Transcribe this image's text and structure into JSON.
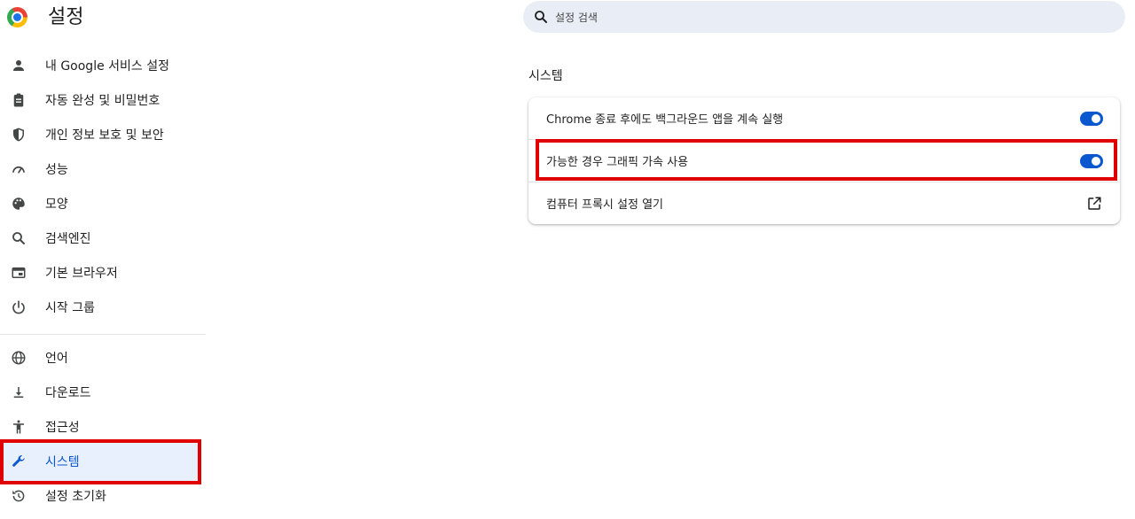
{
  "header": {
    "title": "설정",
    "search_placeholder": "설정 검색"
  },
  "sidebar": {
    "items": [
      {
        "label": "내 Google 서비스 설정",
        "icon": "person-icon"
      },
      {
        "label": "자동 완성 및 비밀번호",
        "icon": "clipboard-icon"
      },
      {
        "label": "개인 정보 보호 및 보안",
        "icon": "shield-icon"
      },
      {
        "label": "성능",
        "icon": "speedometer-icon"
      },
      {
        "label": "모양",
        "icon": "palette-icon"
      },
      {
        "label": "검색엔진",
        "icon": "search-icon"
      },
      {
        "label": "기본 브라우저",
        "icon": "browser-icon"
      },
      {
        "label": "시작 그룹",
        "icon": "power-icon"
      },
      {
        "label": "언어",
        "icon": "globe-icon"
      },
      {
        "label": "다운로드",
        "icon": "download-icon"
      },
      {
        "label": "접근성",
        "icon": "accessibility-icon"
      },
      {
        "label": "시스템",
        "icon": "wrench-icon",
        "selected": true
      },
      {
        "label": "설정 초기화",
        "icon": "history-icon"
      }
    ]
  },
  "main": {
    "section_title": "시스템",
    "rows": [
      {
        "label": "Chrome 종료 후에도 백그라운드 앱을 계속 실행",
        "control": "toggle",
        "checked": true
      },
      {
        "label": "가능한 경우 그래픽 가속 사용",
        "control": "toggle",
        "checked": true
      },
      {
        "label": "컴퓨터 프록시 설정 열기",
        "control": "external-link-icon"
      }
    ]
  },
  "colors": {
    "accent": "#0b57d0",
    "selected_bg": "#e8f0fe",
    "highlight_box": "#e00000",
    "search_bg": "#e9eef6"
  }
}
